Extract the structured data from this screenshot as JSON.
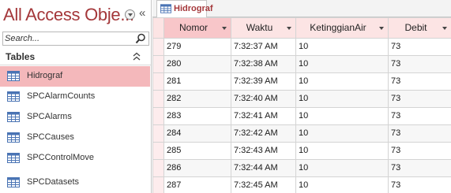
{
  "nav": {
    "title": "All Access Obje...",
    "search_placeholder": "Search...",
    "group_label": "Tables",
    "items": [
      {
        "label": "Hidrograf",
        "selected": true
      },
      {
        "label": "SPCAlarmCounts",
        "selected": false
      },
      {
        "label": "SPCAlarms",
        "selected": false
      },
      {
        "label": "SPCCauses",
        "selected": false
      },
      {
        "label": "SPCControlMove",
        "selected": false
      },
      {
        "label": "SPCDatasets",
        "selected": false
      }
    ]
  },
  "document": {
    "tab_label": "Hidrograf",
    "columns": [
      "Nomor",
      "Waktu",
      "KetinggianAir",
      "Debit"
    ],
    "rows": [
      [
        "279",
        "7:32:37 AM",
        "10",
        "73"
      ],
      [
        "280",
        "7:32:38 AM",
        "10",
        "73"
      ],
      [
        "281",
        "7:32:39 AM",
        "10",
        "73"
      ],
      [
        "282",
        "7:32:40 AM",
        "10",
        "73"
      ],
      [
        "283",
        "7:32:41 AM",
        "10",
        "73"
      ],
      [
        "284",
        "7:32:42 AM",
        "10",
        "73"
      ],
      [
        "285",
        "7:32:43 AM",
        "10",
        "73"
      ],
      [
        "286",
        "7:32:44 AM",
        "10",
        "73"
      ],
      [
        "287",
        "7:32:45 AM",
        "10",
        "73"
      ]
    ]
  },
  "colors": {
    "accent": "#a4373a",
    "selection": "#f4b8bb",
    "header_bg": "#fce4e4"
  }
}
